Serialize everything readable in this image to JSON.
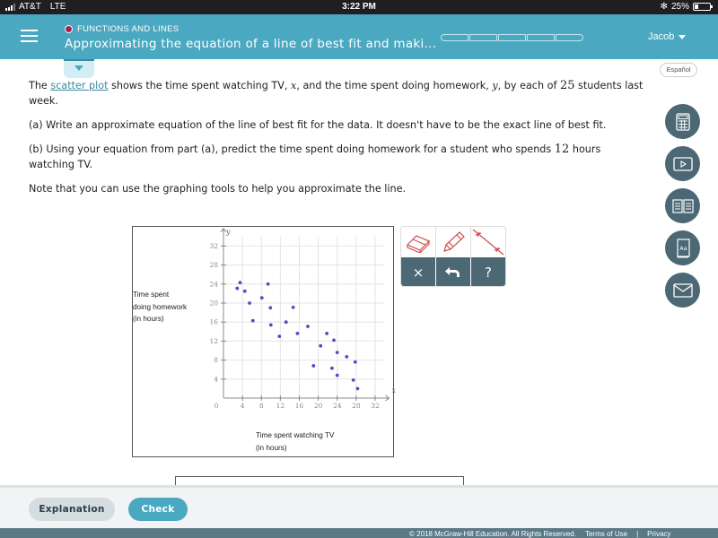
{
  "status_bar": {
    "carrier": "AT&T",
    "network": "LTE",
    "time": "3:22 PM",
    "bluetooth_icon": "bluetooth-icon",
    "battery": "25%",
    "battery_level": 0.25
  },
  "header": {
    "menu_icon": "hamburger-menu-icon",
    "topic": "FUNCTIONS AND LINES",
    "topic_dot_color": "#a5214e",
    "title": "Approximating the equation of a line of best fit and maki...",
    "progress_segments": 5,
    "progress_filled": 0,
    "user_name": "Jacob",
    "accent_color": "#4aa8c1"
  },
  "language_button": "Español",
  "prompt": {
    "p1_pre": "The ",
    "p1_link": "scatter plot",
    "p1_mid1": " shows the time spent watching TV, ",
    "p1_var_x": "x",
    "p1_mid2": ", and the time spent doing homework, ",
    "p1_var_y": "y",
    "p1_mid3": ", by each of ",
    "p1_num": "25",
    "p1_post": " students last week.",
    "p2": "(a) Write an approximate equation of the line of best fit for the data. It doesn't have to be the exact line of best fit.",
    "p3_pre": "(b) Using your equation from part (a), predict the time spent doing homework for a student who spends ",
    "p3_num": "12",
    "p3_post": " hours watching TV.",
    "p4": "Note that you can use the graphing tools to help you approximate the line."
  },
  "side_tools": [
    {
      "name": "calculator",
      "icon": "calculator-icon"
    },
    {
      "name": "video",
      "icon": "video-play-icon"
    },
    {
      "name": "ebook",
      "icon": "open-book-icon"
    },
    {
      "name": "dictionary",
      "icon": "dictionary-icon"
    },
    {
      "name": "message",
      "icon": "envelope-icon"
    }
  ],
  "graph_tools": {
    "top": [
      {
        "name": "eraser",
        "icon": "eraser-icon"
      },
      {
        "name": "pencil",
        "icon": "pencil-icon"
      },
      {
        "name": "line",
        "icon": "line-tool-icon"
      }
    ],
    "bottom": [
      {
        "name": "clear",
        "label": "×",
        "icon": "close-icon"
      },
      {
        "name": "undo",
        "label": "",
        "icon": "undo-icon"
      },
      {
        "name": "help",
        "label": "?",
        "icon": "help-icon"
      }
    ]
  },
  "chart_data": {
    "type": "scatter",
    "title": "",
    "xlabel_lines": [
      "Time spent watching TV",
      "(in hours)"
    ],
    "ylabel_lines": [
      "Time spent",
      "doing homework",
      "(in hours)"
    ],
    "x_axis_var": "x",
    "y_axis_var": "y",
    "origin_label": "0",
    "xlim": [
      0,
      34
    ],
    "ylim": [
      0,
      34
    ],
    "x_ticks": [
      4,
      8,
      12,
      16,
      20,
      24,
      28,
      32
    ],
    "y_ticks": [
      4,
      8,
      12,
      16,
      20,
      24,
      28,
      32
    ],
    "grid": true,
    "point_color": "#4a4fc4",
    "points": [
      {
        "x": 2.9,
        "y": 23.1
      },
      {
        "x": 3.5,
        "y": 24.3
      },
      {
        "x": 4.5,
        "y": 22.5
      },
      {
        "x": 5.5,
        "y": 20.0
      },
      {
        "x": 6.2,
        "y": 16.3
      },
      {
        "x": 8.1,
        "y": 21.1
      },
      {
        "x": 9.4,
        "y": 24.0
      },
      {
        "x": 9.9,
        "y": 19.0
      },
      {
        "x": 10.0,
        "y": 15.4
      },
      {
        "x": 11.8,
        "y": 13.0
      },
      {
        "x": 13.2,
        "y": 16.0
      },
      {
        "x": 14.7,
        "y": 19.1
      },
      {
        "x": 15.6,
        "y": 13.6
      },
      {
        "x": 17.8,
        "y": 15.1
      },
      {
        "x": 19.0,
        "y": 6.8
      },
      {
        "x": 20.5,
        "y": 11.0
      },
      {
        "x": 21.8,
        "y": 13.6
      },
      {
        "x": 23.3,
        "y": 12.2
      },
      {
        "x": 22.9,
        "y": 6.3
      },
      {
        "x": 24.0,
        "y": 9.6
      },
      {
        "x": 24.0,
        "y": 4.8
      },
      {
        "x": 26.0,
        "y": 8.7
      },
      {
        "x": 27.8,
        "y": 7.6
      },
      {
        "x": 27.4,
        "y": 3.8
      },
      {
        "x": 28.3,
        "y": 2.0
      }
    ]
  },
  "buttons": {
    "explanation": "Explanation",
    "check": "Check"
  },
  "footer": {
    "copyright": "© 2018 McGraw-Hill Education. All Rights Reserved.",
    "terms": "Terms of Use",
    "separator": "|",
    "privacy": "Privacy"
  }
}
